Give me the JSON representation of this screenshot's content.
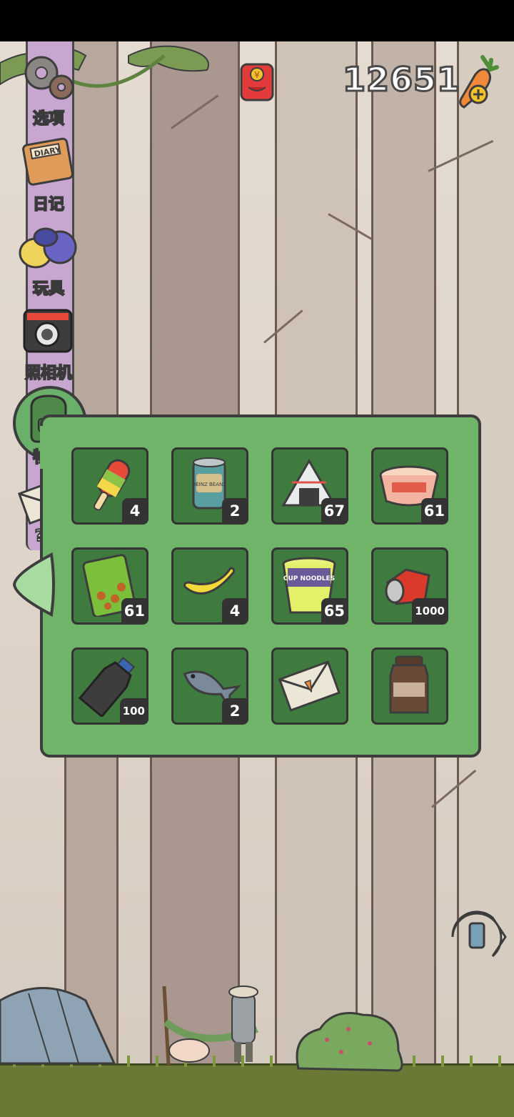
{
  "header": {
    "carrot_count": "12651"
  },
  "icons": {
    "red_packet": "red-packet-icon",
    "carrot_add": "carrot-plus-icon",
    "phone": "phone-icon"
  },
  "sidebar": {
    "items": [
      {
        "label": "选项",
        "icon": "gear-icon"
      },
      {
        "label": "日记",
        "icon": "diary-icon"
      },
      {
        "label": "玩具",
        "icon": "toys-icon"
      },
      {
        "label": "照相机",
        "icon": "camera-icon"
      },
      {
        "label": "物品",
        "icon": "backpack-icon"
      },
      {
        "label": "???",
        "icon": "letter-icon"
      }
    ]
  },
  "inventory": {
    "rows": [
      [
        {
          "name": "popsicle",
          "qty": "4"
        },
        {
          "name": "baked-beans-can",
          "qty": "2"
        },
        {
          "name": "onigiri",
          "qty": "67"
        },
        {
          "name": "instant-noodle-bowl",
          "qty": "61"
        }
      ],
      [
        {
          "name": "snack-bag",
          "qty": "61"
        },
        {
          "name": "banana",
          "qty": "4"
        },
        {
          "name": "cup-noodles",
          "qty": "65"
        },
        {
          "name": "crushed-can",
          "qty": "1000"
        }
      ],
      [
        {
          "name": "plastic-bottle",
          "qty": "100"
        },
        {
          "name": "fish",
          "qty": "2"
        },
        {
          "name": "carrot-letter",
          "qty": ""
        },
        {
          "name": "coffee-jar",
          "qty": ""
        }
      ]
    ],
    "cup_label": "CUP NOODLES",
    "can_label": "HEINZ BEANZ"
  },
  "colors": {
    "panel_green": "#6fb468",
    "slot_green": "#3f7a3f",
    "rail_purple": "#c7a7d0",
    "ground_green": "#6a7a36"
  }
}
